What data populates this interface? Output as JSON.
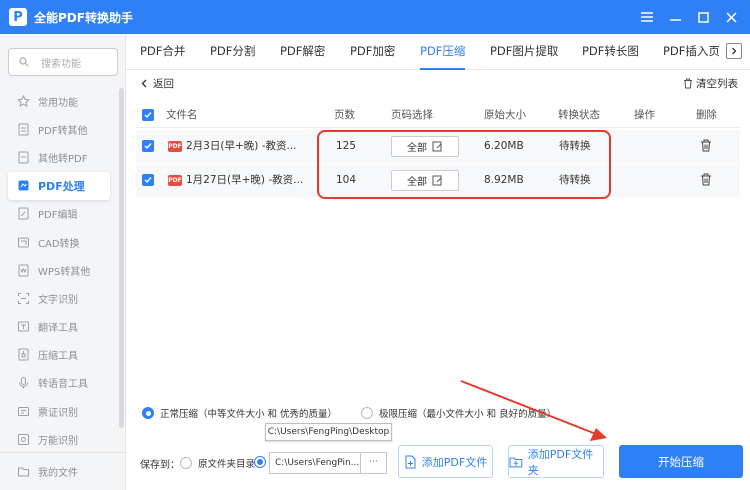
{
  "app": {
    "title": "全能PDF转换助手",
    "logo": "P"
  },
  "sidebar": {
    "search_placeholder": "搜索功能",
    "items": [
      {
        "label": "常用功能",
        "icon": "star-icon"
      },
      {
        "label": "PDF转其他",
        "icon": "pdf-export-icon"
      },
      {
        "label": "其他转PDF",
        "icon": "pdf-import-icon"
      },
      {
        "label": "PDF处理",
        "icon": "pdf-tool-icon",
        "active": true
      },
      {
        "label": "PDF编辑",
        "icon": "edit-icon"
      },
      {
        "label": "CAD转换",
        "icon": "cad-icon"
      },
      {
        "label": "WPS转其他",
        "icon": "wps-icon"
      },
      {
        "label": "文字识别",
        "icon": "ocr-icon"
      },
      {
        "label": "翻译工具",
        "icon": "translate-icon"
      },
      {
        "label": "压缩工具",
        "icon": "compress-icon"
      },
      {
        "label": "转语音工具",
        "icon": "voice-icon"
      },
      {
        "label": "票证识别",
        "icon": "ticket-icon"
      },
      {
        "label": "万能识别",
        "icon": "scan-icon"
      }
    ],
    "my_files": "我的文件"
  },
  "tabs": [
    {
      "label": "PDF合并"
    },
    {
      "label": "PDF分割"
    },
    {
      "label": "PDF解密"
    },
    {
      "label": "PDF加密"
    },
    {
      "label": "PDF压缩",
      "active": true
    },
    {
      "label": "PDF图片提取"
    },
    {
      "label": "PDF转长图"
    },
    {
      "label": "PDF插入页"
    }
  ],
  "toolbar": {
    "back": "返回",
    "clear": "清空列表"
  },
  "table": {
    "headers": {
      "name": "文件名",
      "pages": "页数",
      "page_select": "页码选择",
      "size": "原始大小",
      "status": "转换状态",
      "action": "操作",
      "delete": "删除"
    },
    "rows": [
      {
        "name": "2月3日(早+晚) -教资...",
        "pages": "125",
        "page_btn": "全部",
        "size": "6.20MB",
        "status": "待转换"
      },
      {
        "name": "1月27日(早+晚) -教资...",
        "pages": "104",
        "page_btn": "全部",
        "size": "8.92MB",
        "status": "待转换"
      }
    ]
  },
  "options": {
    "normal": "正常压缩（中等文件大小 和 优秀的质量）",
    "extreme": "极限压缩（最小文件大小 和 良好的质量）"
  },
  "footer": {
    "save_to": "保存到：",
    "original_dir": "原文件夹目录",
    "path_tooltip": "C:\\Users\\FengPing\\Desktop",
    "path_value": "C:\\Users\\FengPin...",
    "more": "···",
    "add_file": "添加PDF文件",
    "add_folder": "添加PDF文件夹",
    "start": "开始压缩"
  },
  "colors": {
    "accent": "#2f7ff7",
    "annotation": "#e23b2e",
    "pdf_icon": "#e84c3d"
  }
}
